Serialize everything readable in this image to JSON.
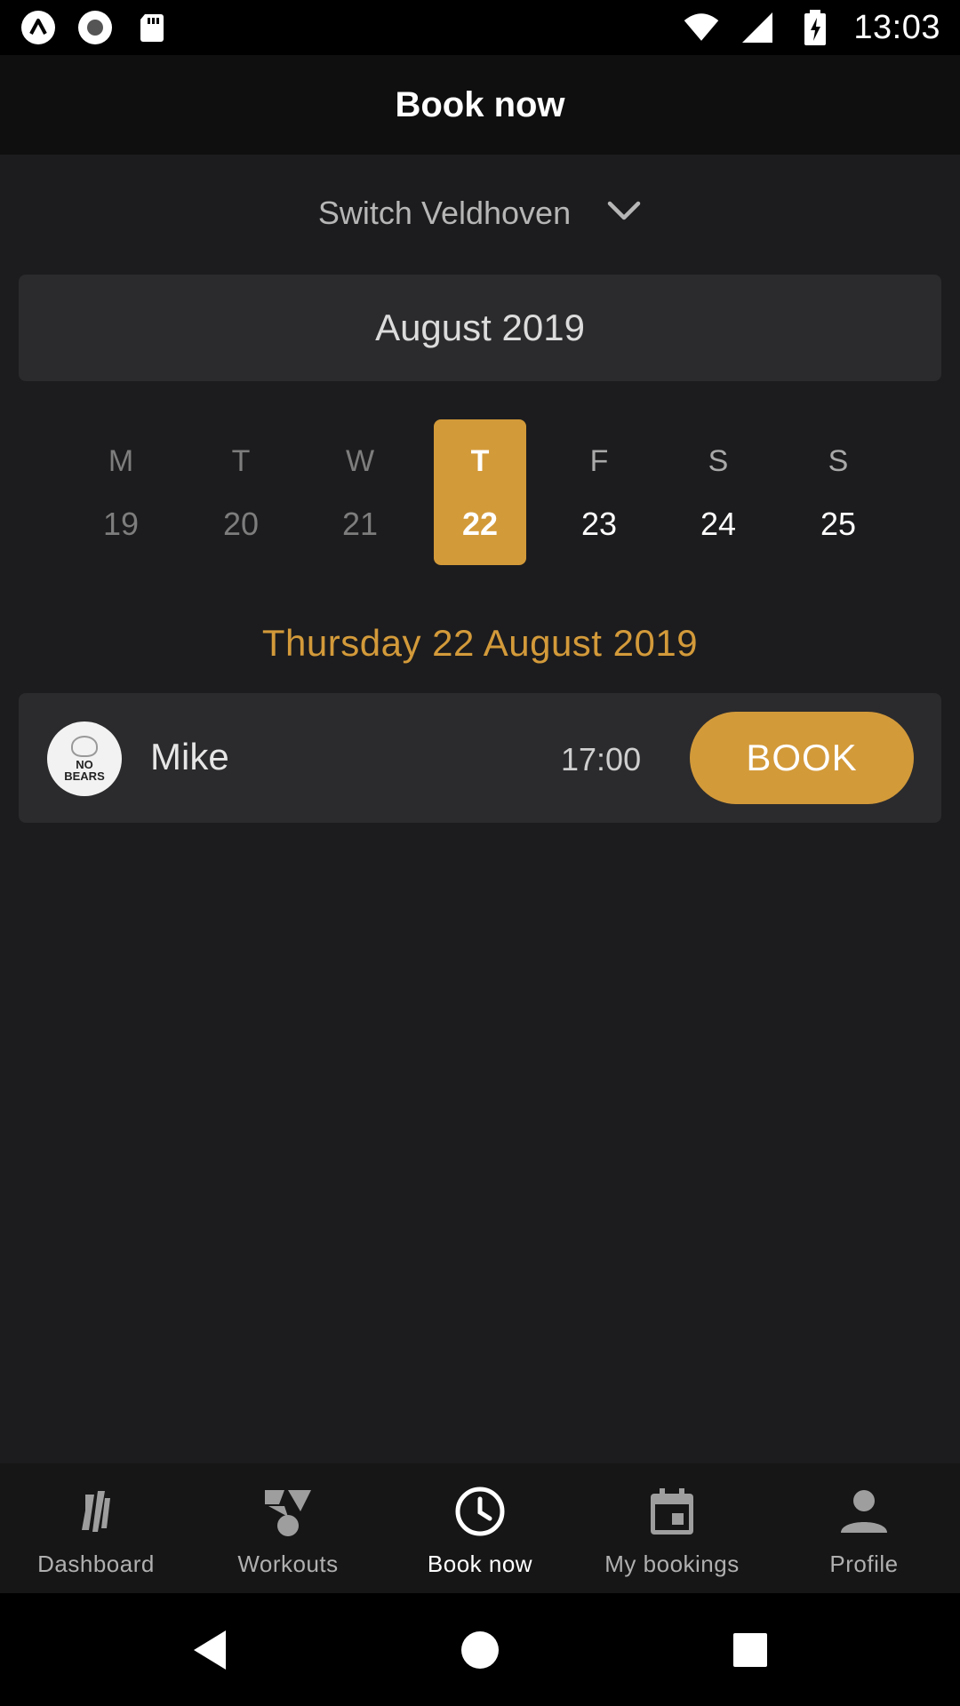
{
  "status_bar": {
    "time": "13:03",
    "left_icons": [
      "app-a-icon",
      "record-icon",
      "sd-card-icon"
    ],
    "right_icons": [
      "wifi-icon",
      "cell-signal-icon",
      "battery-charging-icon"
    ]
  },
  "app_bar": {
    "title": "Book now"
  },
  "location": {
    "label": "Switch Veldhoven",
    "icon": "chevron-down-icon"
  },
  "calendar": {
    "month_label": "August 2019",
    "days": [
      {
        "weekday": "M",
        "date": "19",
        "state": "past"
      },
      {
        "weekday": "T",
        "date": "20",
        "state": "past"
      },
      {
        "weekday": "W",
        "date": "21",
        "state": "past"
      },
      {
        "weekday": "T",
        "date": "22",
        "state": "selected"
      },
      {
        "weekday": "F",
        "date": "23",
        "state": "future"
      },
      {
        "weekday": "S",
        "date": "24",
        "state": "future"
      },
      {
        "weekday": "S",
        "date": "25",
        "state": "future"
      }
    ],
    "selected_date_label": "Thursday 22 August 2019"
  },
  "sessions": [
    {
      "trainer": "Mike",
      "avatar_text": [
        "NO",
        "BEARS"
      ],
      "time": "17:00",
      "button_label": "BOOK"
    }
  ],
  "bottom_nav": {
    "items": [
      {
        "label": "Dashboard",
        "icon": "dashboard-icon",
        "active": false
      },
      {
        "label": "Workouts",
        "icon": "workouts-icon",
        "active": false
      },
      {
        "label": "Book now",
        "icon": "clock-icon",
        "active": true
      },
      {
        "label": "My bookings",
        "icon": "calendar-icon",
        "active": false
      },
      {
        "label": "Profile",
        "icon": "person-icon",
        "active": false
      }
    ]
  },
  "system_nav": {
    "icons": [
      "back-icon",
      "home-icon",
      "recents-icon"
    ]
  },
  "colors": {
    "accent": "#d39a3a",
    "background": "#1c1c1e",
    "card": "#2b2b2d",
    "appbar": "#0f0f0f"
  }
}
